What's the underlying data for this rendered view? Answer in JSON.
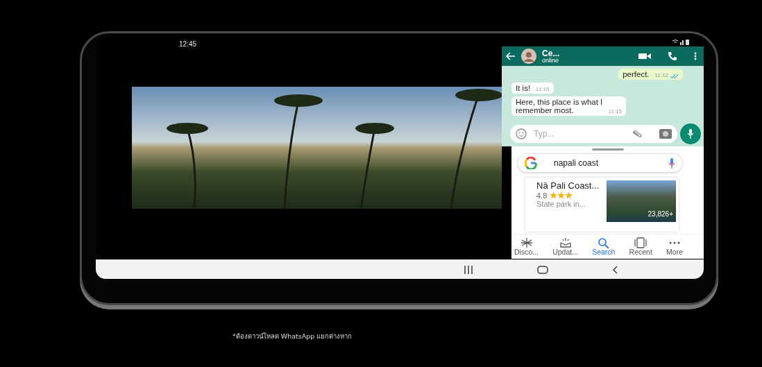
{
  "status_bar": {
    "time": "12:45"
  },
  "chat": {
    "contact_name": "Ce...",
    "contact_status": "online",
    "placeholder": "Typ...",
    "messages": [
      {
        "text": "perfect.",
        "time": "11:12",
        "outgoing": true,
        "read": true
      },
      {
        "text": "It is!",
        "time": "11:15",
        "outgoing": false,
        "read": false
      },
      {
        "text": "Here, this place is what I remember most.",
        "time": "11:15",
        "outgoing": false,
        "read": false
      }
    ]
  },
  "search": {
    "query": "napali coast",
    "result": {
      "title": "Nā Pali Coast...",
      "rating": "4.8",
      "stars": 3,
      "subtitle": "State park in...",
      "photo_count": "23,826+"
    },
    "nav": [
      {
        "kind": "discover",
        "label": "Disco...",
        "selected": false
      },
      {
        "kind": "updates",
        "label": "Updat...",
        "selected": false
      },
      {
        "kind": "search",
        "label": "Search",
        "selected": true
      },
      {
        "kind": "recent",
        "label": "Recent",
        "selected": false
      },
      {
        "kind": "more",
        "label": "More",
        "selected": false
      }
    ]
  },
  "footnote": "*ต้องดาวน์โหลด WhatsApp แยกต่างหาก"
}
